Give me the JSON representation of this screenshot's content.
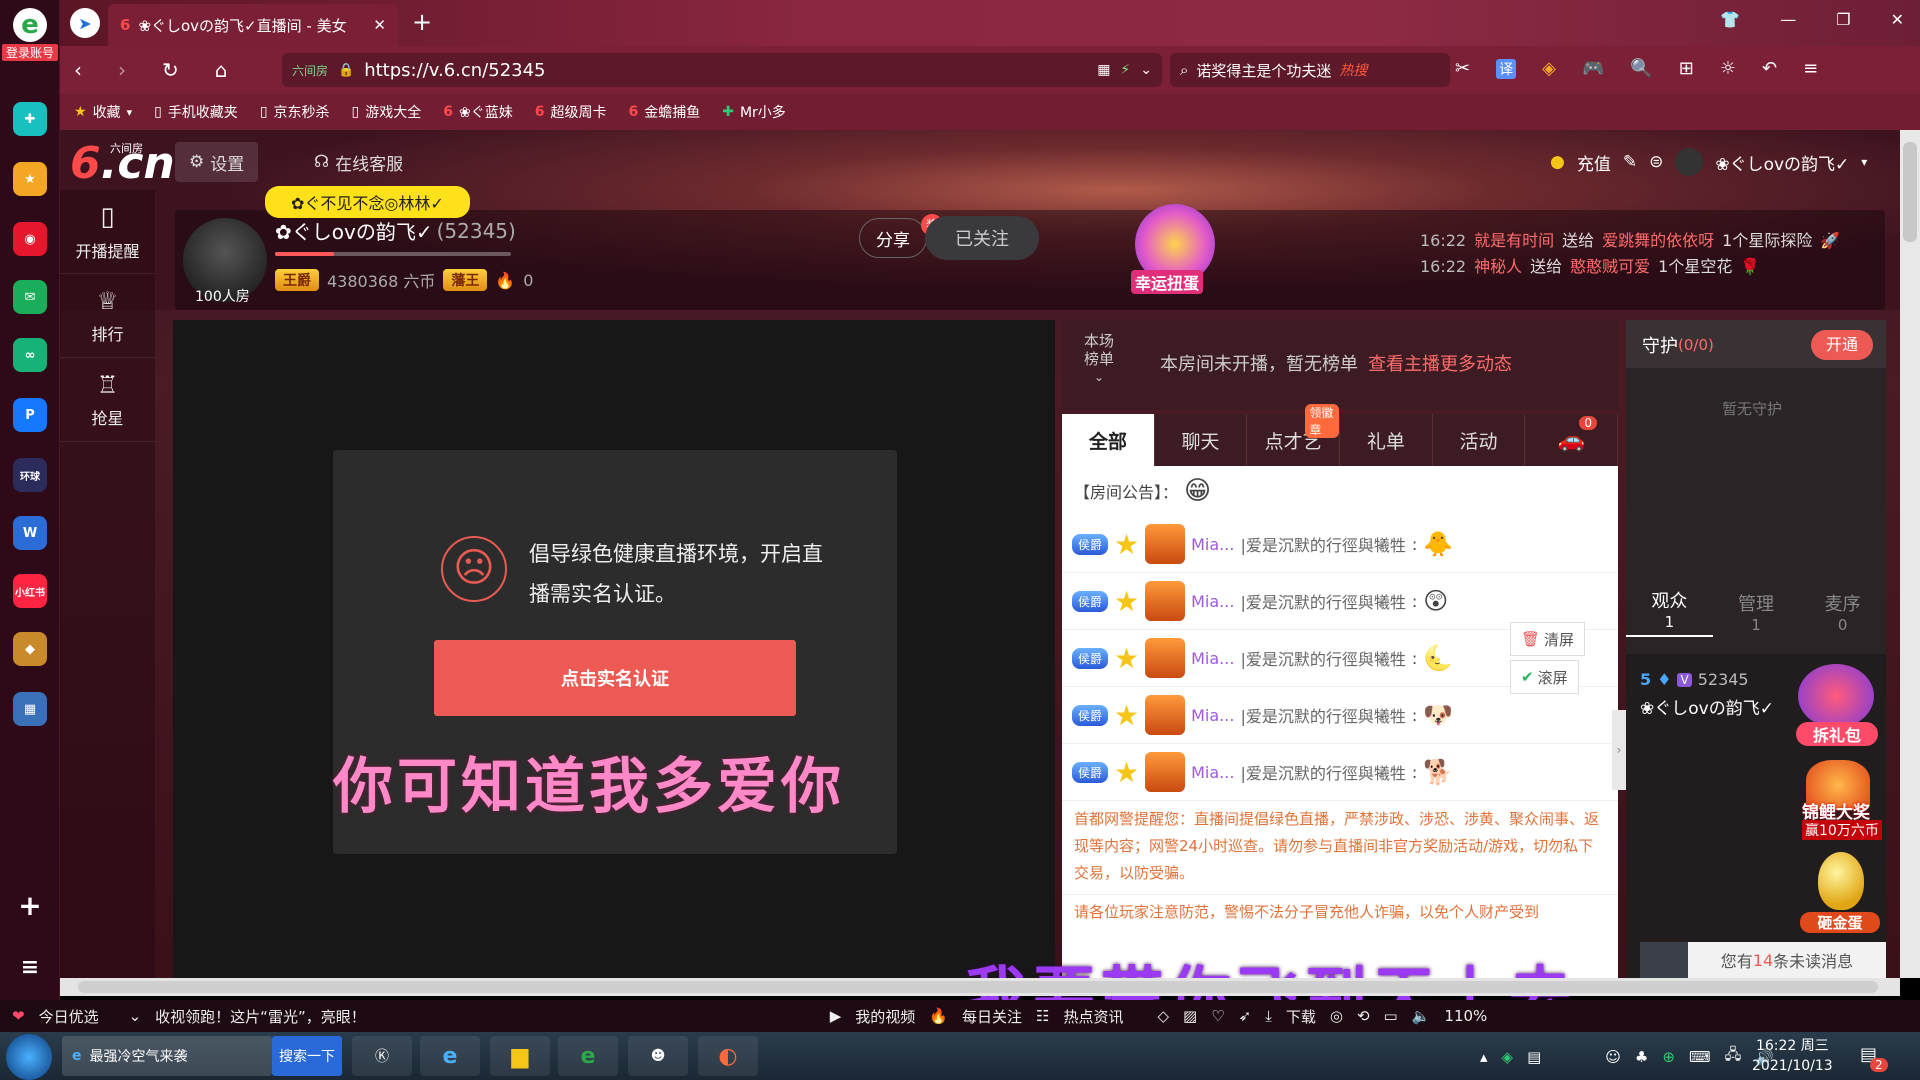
{
  "dock": {
    "login_label": "登录账号"
  },
  "browser": {
    "tab_title": "❀ぐしovの韵飞✓直播间 - 美女",
    "url": "https://v.6.cn/52345",
    "url_prefix": "六间房",
    "search_text": "诺奖得主是个功夫迷",
    "search_badge": "热搜",
    "bookmarks": [
      "收藏",
      "手机收藏夹",
      "京东秒杀",
      "游戏大全",
      "❀ぐ蓝妹",
      "超级周卡",
      "金蟾捕鱼",
      "Mr小多"
    ]
  },
  "site": {
    "logo_text": ".cn",
    "logo_sub": "六间房",
    "settings_label": "设置",
    "service_label": "在线客服",
    "recharge_label": "充值",
    "user_name": "❀ぐしovの韵飞✓"
  },
  "leftnav": [
    {
      "label": "开播提醒",
      "icon": "phone-icon"
    },
    {
      "label": "排行",
      "icon": "crown-icon"
    },
    {
      "label": "抢星",
      "icon": "star-bag-icon"
    }
  ],
  "host": {
    "bubble": "✿ぐ不见不念◎林林✓",
    "name": "✿ぐしovの韵飞✓",
    "room_id": "(52345)",
    "badge_title": "王爵",
    "coins": "4380368 六币",
    "badge_rank": "藩王",
    "heat": "0",
    "room_label": "100人房",
    "share_label": "分享",
    "share_badge": "奖",
    "follow_label": "已关注",
    "lucky_label": "幸运扭蛋"
  },
  "ticker": [
    {
      "time": "16:22",
      "from": "就是有时间",
      "verb": "送给",
      "to": "爱跳舞的依依呀",
      "gift": "1个星际探险"
    },
    {
      "time": "16:22",
      "from": "神秘人",
      "verb": "送给",
      "to": "憨憨贼可爱",
      "gift": "1个星空花"
    }
  ],
  "video": {
    "notice_text": "倡导绿色健康直播环境，开启直播需实名认证。",
    "notice_button": "点击实名认证",
    "lyric_1": "你可知道我多爱你",
    "lyric_2": "我要带你飞到天上去"
  },
  "rank": {
    "label_1": "本场",
    "label_2": "榜单",
    "text": "本房间未开播，暂无榜单",
    "link": "查看主播更多动态"
  },
  "chat": {
    "tabs": [
      "全部",
      "聊天",
      "点才艺",
      "礼单",
      "活动"
    ],
    "tab_badge": "领徽章",
    "car_badge": "0",
    "announcement": "【房间公告】：",
    "rows": [
      {
        "name": "Mia...",
        "msg": "|爱是沉默的行徑與犧牲",
        "icon": "duck-icon",
        "badge": "侯爵"
      },
      {
        "name": "Mia...",
        "msg": "|爱是沉默的行徑與犧牲",
        "icon": "shocked-face-icon",
        "badge": "侯爵"
      },
      {
        "name": "Mia...",
        "msg": "|爱是沉默的行徑與犧牲",
        "icon": "moon-icon",
        "badge": "侯爵"
      },
      {
        "name": "Mia...",
        "msg": "|爱是沉默的行徑與犧牲",
        "icon": "dog-icon",
        "badge": "侯爵"
      },
      {
        "name": "Mia...",
        "msg": "|爱是沉默的行徑與犧牲",
        "icon": "shiba-icon",
        "badge": "侯爵"
      }
    ],
    "clear_label": "清屏",
    "scroll_label": "滚屏",
    "police_notice": "首都网警提醒您：直播间提倡绿色直播，严禁涉政、涉恐、涉黄、聚众闹事、返现等内容；网警24小时巡查。请勿参与直播间非官方奖励活动/游戏，切勿私下交易，以防受骗。",
    "warn_notice": "请各位玩家注意防范，警惕不法分子冒充他人诈骗，以免个人财产受到"
  },
  "guard": {
    "title": "守护",
    "count": "(0/0)",
    "open_label": "开通",
    "empty_text": "暂无守护"
  },
  "audience": {
    "tabs": [
      {
        "label": "观众",
        "count": "1"
      },
      {
        "label": "管理",
        "count": "1"
      },
      {
        "label": "麦序",
        "count": "0"
      }
    ],
    "user_level": "5",
    "user_id": "52345",
    "user_name": "❀ぐしovの韵飞✓",
    "gift_pack": "拆礼包",
    "koi_label": "锦鲤大奖",
    "koi_sub": "赢10万六币",
    "egg_label": "砸金蛋",
    "unread_prefix": "您有",
    "unread_count": "14",
    "unread_suffix": "条未读消息"
  },
  "status": {
    "today": "今日优选",
    "ticker": "收视领跑！这片“雷光”，亮眼！",
    "my_video": "我的视频",
    "daily": "每日关注",
    "hot": "热点资讯",
    "download": "下载",
    "zoom": "110%"
  },
  "taskbar": {
    "ie_text": "最强冷空气来袭",
    "search_label": "搜索一下",
    "time": "16:22 周三",
    "date": "2021/10/13",
    "notify_count": "2"
  }
}
